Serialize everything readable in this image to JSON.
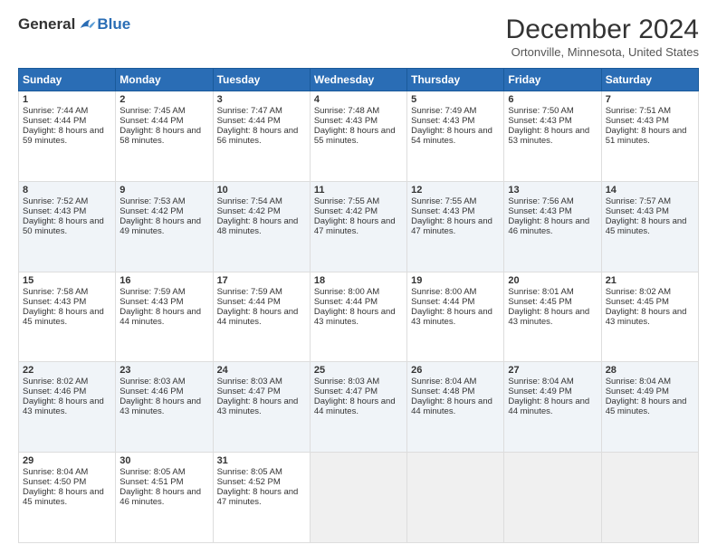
{
  "header": {
    "logo": {
      "general": "General",
      "blue": "Blue"
    },
    "title": "December 2024",
    "location": "Ortonville, Minnesota, United States"
  },
  "days": [
    "Sunday",
    "Monday",
    "Tuesday",
    "Wednesday",
    "Thursday",
    "Friday",
    "Saturday"
  ],
  "weeks": [
    [
      {
        "day": "1",
        "sunrise": "Sunrise: 7:44 AM",
        "sunset": "Sunset: 4:44 PM",
        "daylight": "Daylight: 8 hours and 59 minutes."
      },
      {
        "day": "2",
        "sunrise": "Sunrise: 7:45 AM",
        "sunset": "Sunset: 4:44 PM",
        "daylight": "Daylight: 8 hours and 58 minutes."
      },
      {
        "day": "3",
        "sunrise": "Sunrise: 7:47 AM",
        "sunset": "Sunset: 4:44 PM",
        "daylight": "Daylight: 8 hours and 56 minutes."
      },
      {
        "day": "4",
        "sunrise": "Sunrise: 7:48 AM",
        "sunset": "Sunset: 4:43 PM",
        "daylight": "Daylight: 8 hours and 55 minutes."
      },
      {
        "day": "5",
        "sunrise": "Sunrise: 7:49 AM",
        "sunset": "Sunset: 4:43 PM",
        "daylight": "Daylight: 8 hours and 54 minutes."
      },
      {
        "day": "6",
        "sunrise": "Sunrise: 7:50 AM",
        "sunset": "Sunset: 4:43 PM",
        "daylight": "Daylight: 8 hours and 53 minutes."
      },
      {
        "day": "7",
        "sunrise": "Sunrise: 7:51 AM",
        "sunset": "Sunset: 4:43 PM",
        "daylight": "Daylight: 8 hours and 51 minutes."
      }
    ],
    [
      {
        "day": "8",
        "sunrise": "Sunrise: 7:52 AM",
        "sunset": "Sunset: 4:43 PM",
        "daylight": "Daylight: 8 hours and 50 minutes."
      },
      {
        "day": "9",
        "sunrise": "Sunrise: 7:53 AM",
        "sunset": "Sunset: 4:42 PM",
        "daylight": "Daylight: 8 hours and 49 minutes."
      },
      {
        "day": "10",
        "sunrise": "Sunrise: 7:54 AM",
        "sunset": "Sunset: 4:42 PM",
        "daylight": "Daylight: 8 hours and 48 minutes."
      },
      {
        "day": "11",
        "sunrise": "Sunrise: 7:55 AM",
        "sunset": "Sunset: 4:42 PM",
        "daylight": "Daylight: 8 hours and 47 minutes."
      },
      {
        "day": "12",
        "sunrise": "Sunrise: 7:55 AM",
        "sunset": "Sunset: 4:43 PM",
        "daylight": "Daylight: 8 hours and 47 minutes."
      },
      {
        "day": "13",
        "sunrise": "Sunrise: 7:56 AM",
        "sunset": "Sunset: 4:43 PM",
        "daylight": "Daylight: 8 hours and 46 minutes."
      },
      {
        "day": "14",
        "sunrise": "Sunrise: 7:57 AM",
        "sunset": "Sunset: 4:43 PM",
        "daylight": "Daylight: 8 hours and 45 minutes."
      }
    ],
    [
      {
        "day": "15",
        "sunrise": "Sunrise: 7:58 AM",
        "sunset": "Sunset: 4:43 PM",
        "daylight": "Daylight: 8 hours and 45 minutes."
      },
      {
        "day": "16",
        "sunrise": "Sunrise: 7:59 AM",
        "sunset": "Sunset: 4:43 PM",
        "daylight": "Daylight: 8 hours and 44 minutes."
      },
      {
        "day": "17",
        "sunrise": "Sunrise: 7:59 AM",
        "sunset": "Sunset: 4:44 PM",
        "daylight": "Daylight: 8 hours and 44 minutes."
      },
      {
        "day": "18",
        "sunrise": "Sunrise: 8:00 AM",
        "sunset": "Sunset: 4:44 PM",
        "daylight": "Daylight: 8 hours and 43 minutes."
      },
      {
        "day": "19",
        "sunrise": "Sunrise: 8:00 AM",
        "sunset": "Sunset: 4:44 PM",
        "daylight": "Daylight: 8 hours and 43 minutes."
      },
      {
        "day": "20",
        "sunrise": "Sunrise: 8:01 AM",
        "sunset": "Sunset: 4:45 PM",
        "daylight": "Daylight: 8 hours and 43 minutes."
      },
      {
        "day": "21",
        "sunrise": "Sunrise: 8:02 AM",
        "sunset": "Sunset: 4:45 PM",
        "daylight": "Daylight: 8 hours and 43 minutes."
      }
    ],
    [
      {
        "day": "22",
        "sunrise": "Sunrise: 8:02 AM",
        "sunset": "Sunset: 4:46 PM",
        "daylight": "Daylight: 8 hours and 43 minutes."
      },
      {
        "day": "23",
        "sunrise": "Sunrise: 8:03 AM",
        "sunset": "Sunset: 4:46 PM",
        "daylight": "Daylight: 8 hours and 43 minutes."
      },
      {
        "day": "24",
        "sunrise": "Sunrise: 8:03 AM",
        "sunset": "Sunset: 4:47 PM",
        "daylight": "Daylight: 8 hours and 43 minutes."
      },
      {
        "day": "25",
        "sunrise": "Sunrise: 8:03 AM",
        "sunset": "Sunset: 4:47 PM",
        "daylight": "Daylight: 8 hours and 44 minutes."
      },
      {
        "day": "26",
        "sunrise": "Sunrise: 8:04 AM",
        "sunset": "Sunset: 4:48 PM",
        "daylight": "Daylight: 8 hours and 44 minutes."
      },
      {
        "day": "27",
        "sunrise": "Sunrise: 8:04 AM",
        "sunset": "Sunset: 4:49 PM",
        "daylight": "Daylight: 8 hours and 44 minutes."
      },
      {
        "day": "28",
        "sunrise": "Sunrise: 8:04 AM",
        "sunset": "Sunset: 4:49 PM",
        "daylight": "Daylight: 8 hours and 45 minutes."
      }
    ],
    [
      {
        "day": "29",
        "sunrise": "Sunrise: 8:04 AM",
        "sunset": "Sunset: 4:50 PM",
        "daylight": "Daylight: 8 hours and 45 minutes."
      },
      {
        "day": "30",
        "sunrise": "Sunrise: 8:05 AM",
        "sunset": "Sunset: 4:51 PM",
        "daylight": "Daylight: 8 hours and 46 minutes."
      },
      {
        "day": "31",
        "sunrise": "Sunrise: 8:05 AM",
        "sunset": "Sunset: 4:52 PM",
        "daylight": "Daylight: 8 hours and 47 minutes."
      },
      null,
      null,
      null,
      null
    ]
  ]
}
